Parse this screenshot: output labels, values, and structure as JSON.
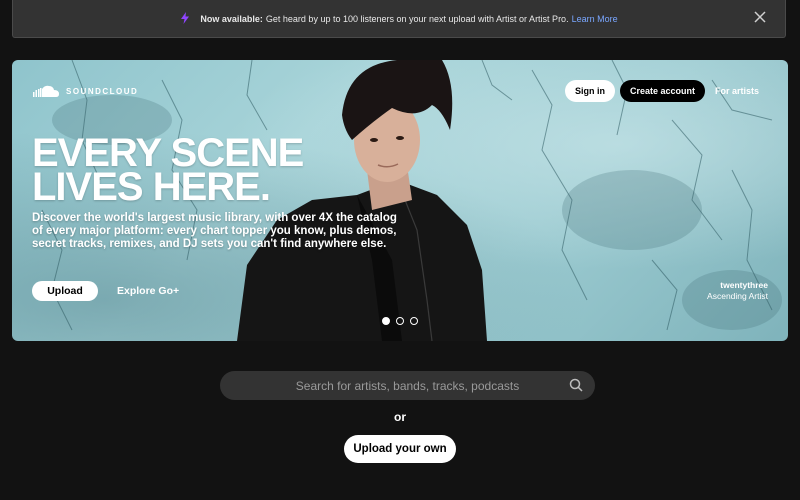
{
  "banner": {
    "icon": "lightning-bolt-icon",
    "bold_text": "Now available:",
    "text": "Get heard by up to 100 listeners on your next upload with Artist or Artist Pro.",
    "link_text": "Learn More",
    "close_icon": "close-icon"
  },
  "header": {
    "logo_text": "SOUNDCLOUD",
    "sign_in": "Sign in",
    "create_account": "Create account",
    "for_artists": "For artists"
  },
  "hero": {
    "headline_line1": "EVERY SCENE",
    "headline_line2": "LIVES HERE.",
    "subtext": "Discover the world's largest music library, with over 4X the catalog of every major platform: every chart topper you know, plus demos, secret tracks, remixes, and DJ sets you can't find anywhere else.",
    "upload_button": "Upload",
    "explore_button": "Explore Go+",
    "artist_name": "twentythree",
    "artist_caption": "Ascending Artist",
    "carousel_count": 3,
    "carousel_active": 0
  },
  "search": {
    "placeholder": "Search for artists, bands, tracks, podcasts",
    "icon": "search-icon"
  },
  "or_text": "or",
  "upload_own": "Upload your own",
  "colors": {
    "background": "#121212",
    "banner_bg": "#333333",
    "accent_link": "#7aa7ff",
    "bolt": "#8f45ff",
    "hero_wall": "#9ccbd1"
  }
}
